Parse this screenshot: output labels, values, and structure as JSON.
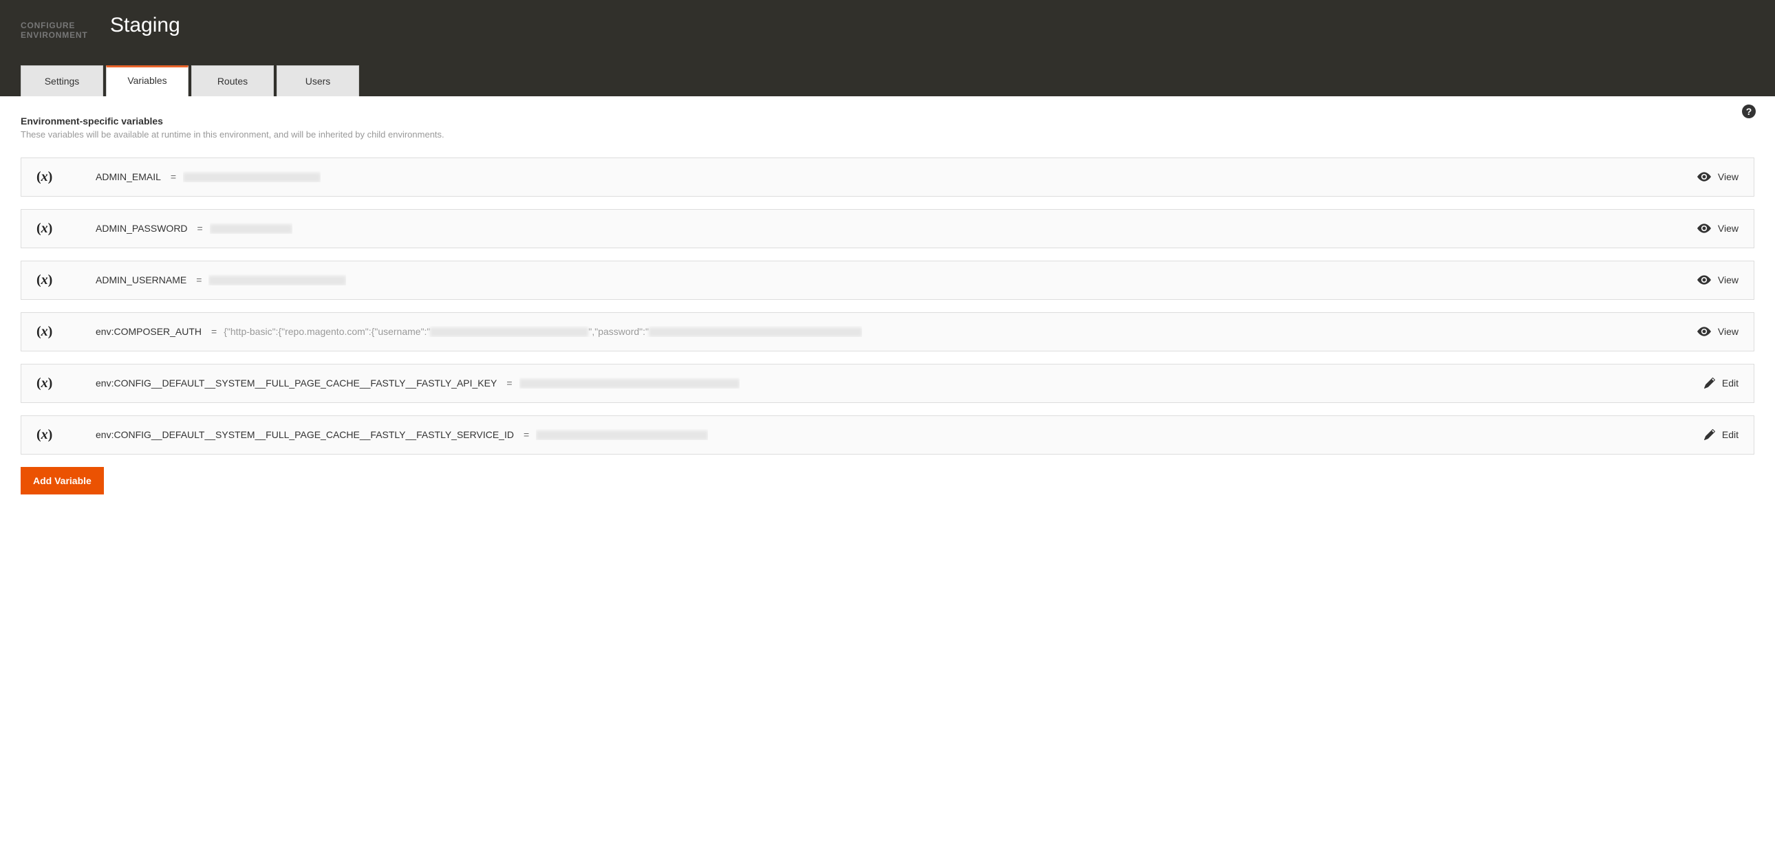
{
  "header": {
    "breadcrumb_line1": "CONFIGURE",
    "breadcrumb_line2": "ENVIRONMENT",
    "title": "Staging"
  },
  "tabs": [
    {
      "label": "Settings",
      "active": false
    },
    {
      "label": "Variables",
      "active": true
    },
    {
      "label": "Routes",
      "active": false
    },
    {
      "label": "Users",
      "active": false
    }
  ],
  "section": {
    "title": "Environment-specific variables",
    "subtitle": "These variables will be available at runtime in this environment, and will be inherited by child environments."
  },
  "variables": [
    {
      "name": "ADMIN_EMAIL",
      "value": "",
      "obscured": true,
      "value_preview": "",
      "action": "View"
    },
    {
      "name": "ADMIN_PASSWORD",
      "value": "",
      "obscured": true,
      "value_preview": "",
      "action": "View"
    },
    {
      "name": "ADMIN_USERNAME",
      "value": "",
      "obscured": true,
      "value_preview": "",
      "action": "View"
    },
    {
      "name": "env:COMPOSER_AUTH",
      "value": "{\"http-basic\":{\"repo.magento.com\":{\"username\":\"",
      "value_suffix": "\",\"password\":\"",
      "obscured": "partial",
      "action": "View"
    },
    {
      "name": "env:CONFIG__DEFAULT__SYSTEM__FULL_PAGE_CACHE__FASTLY__FASTLY_API_KEY",
      "value": "",
      "obscured": true,
      "action": "Edit"
    },
    {
      "name": "env:CONFIG__DEFAULT__SYSTEM__FULL_PAGE_CACHE__FASTLY__FASTLY_SERVICE_ID",
      "value": "",
      "obscured": true,
      "action": "Edit"
    }
  ],
  "buttons": {
    "add_variable": "Add Variable"
  },
  "help_glyph": "?"
}
